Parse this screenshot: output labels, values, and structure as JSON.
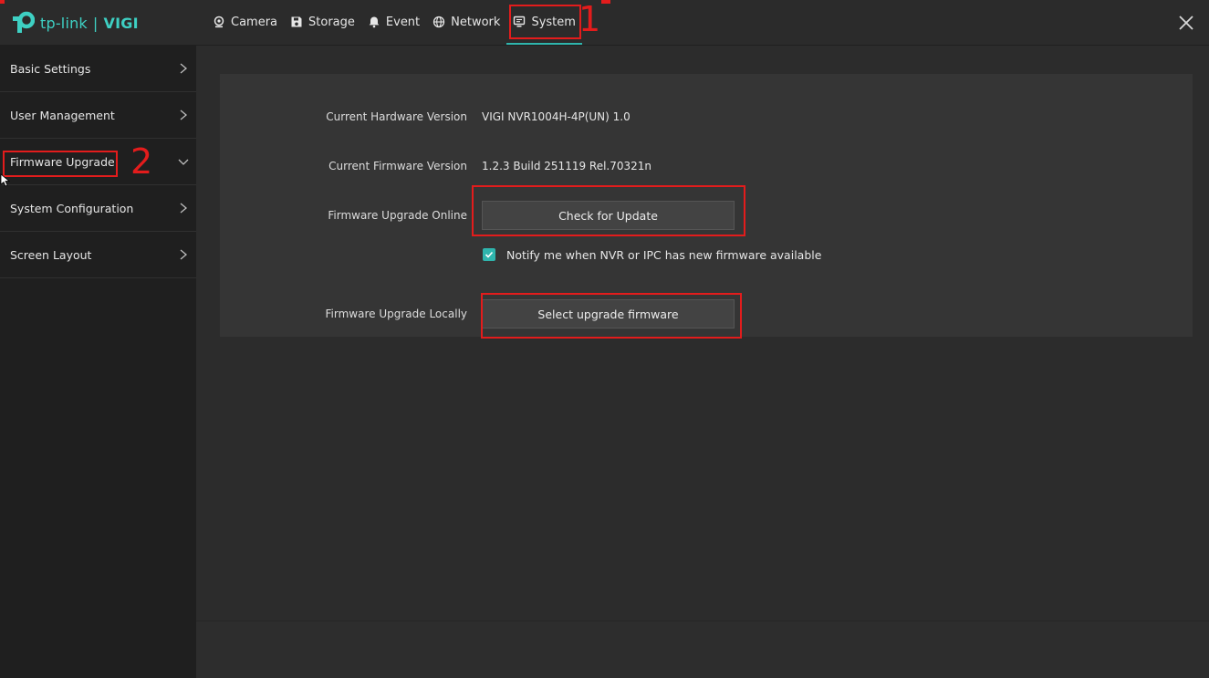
{
  "brand": {
    "name": "tp-link",
    "separator": "|",
    "product": "VIGI"
  },
  "nav": {
    "items": [
      {
        "label": "Camera",
        "icon": "camera-icon"
      },
      {
        "label": "Storage",
        "icon": "storage-icon"
      },
      {
        "label": "Event",
        "icon": "bell-icon"
      },
      {
        "label": "Network",
        "icon": "globe-icon"
      },
      {
        "label": "System",
        "icon": "monitor-icon",
        "active": true
      }
    ],
    "annotation": "1"
  },
  "sidebar": {
    "items": [
      {
        "label": "Basic Settings"
      },
      {
        "label": "User Management"
      },
      {
        "label": "Firmware Upgrade",
        "active": true
      },
      {
        "label": "System Configuration"
      },
      {
        "label": "Screen Layout"
      }
    ],
    "annotation": "2"
  },
  "main": {
    "hardware_label": "Current Hardware Version",
    "hardware_value": "VIGI NVR1004H-4P(UN) 1.0",
    "firmware_label": "Current Firmware Version",
    "firmware_value": "1.2.3 Build 251119 Rel.70321n",
    "online_label": "Firmware Upgrade Online",
    "online_button": "Check for Update",
    "notify_label": "Notify me when NVR or IPC has new firmware available",
    "notify_checked": true,
    "local_label": "Firmware Upgrade Locally",
    "local_button": "Select upgrade firmware"
  },
  "colors": {
    "accent": "#2fb5ad",
    "brand": "#3ed0c3",
    "annotation": "#e31c1c"
  }
}
